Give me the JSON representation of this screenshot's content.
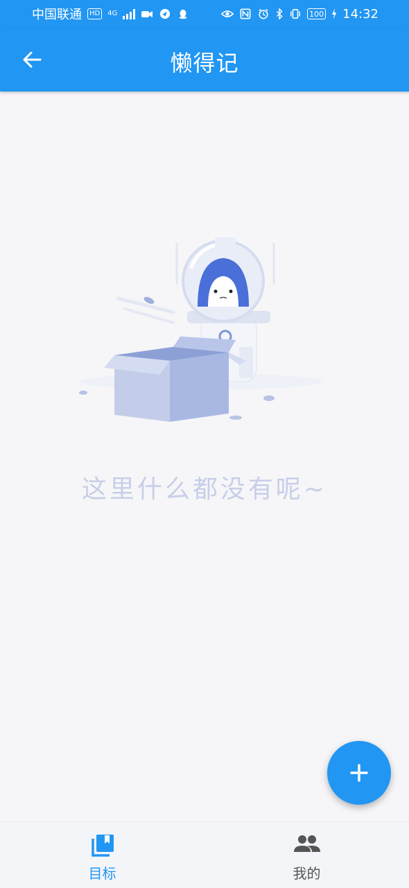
{
  "status_bar": {
    "carrier": "中国联通",
    "hd_badge": "HD",
    "network": "4G",
    "battery": "100",
    "time": "14:32"
  },
  "app_bar": {
    "title": "懒得记",
    "back_icon": "arrow-left-icon"
  },
  "empty_state": {
    "message": "这里什么都没有呢~",
    "illustration": "astronaut-shark-with-box"
  },
  "fab": {
    "icon": "plus-icon"
  },
  "bottom_nav": {
    "items": [
      {
        "label": "目标",
        "icon": "bookmark-book-icon",
        "active": true
      },
      {
        "label": "我的",
        "icon": "people-icon",
        "active": false
      }
    ]
  },
  "colors": {
    "primary": "#2196f3",
    "background": "#f6f6f8",
    "empty_text": "#c7cee8",
    "inactive_nav": "#555555"
  }
}
